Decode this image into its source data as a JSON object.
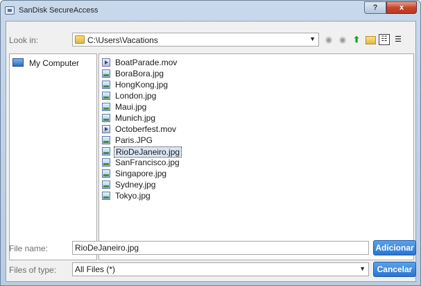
{
  "window": {
    "title": "SanDisk SecureAccess",
    "help_label": "?",
    "close_label": "x"
  },
  "toolbar": {
    "lookin_label": "Look in:",
    "lookin_path": "C:\\Users\\Vacations",
    "back_icon": "back-arrow-icon",
    "forward_icon": "forward-arrow-icon",
    "up_icon": "up-folder-icon",
    "new_folder_icon": "new-folder-icon",
    "list_view_icon": "list-view-icon",
    "details_view_icon": "details-view-icon"
  },
  "places": [
    {
      "label": "My Computer",
      "icon": "computer-icon"
    }
  ],
  "files": [
    {
      "name": "BoatParade.mov",
      "type": "movie"
    },
    {
      "name": "BoraBora.jpg",
      "type": "image"
    },
    {
      "name": "HongKong.jpg",
      "type": "image"
    },
    {
      "name": "London.jpg",
      "type": "image"
    },
    {
      "name": "Maui.jpg",
      "type": "image"
    },
    {
      "name": "Munich.jpg",
      "type": "image"
    },
    {
      "name": "Octoberfest.mov",
      "type": "movie"
    },
    {
      "name": "Paris.JPG",
      "type": "image"
    },
    {
      "name": "RioDeJaneiro.jpg",
      "type": "image",
      "selected": true
    },
    {
      "name": "SanFrancisco.jpg",
      "type": "image"
    },
    {
      "name": "Singapore.jpg",
      "type": "image"
    },
    {
      "name": "Sydney.jpg",
      "type": "image"
    },
    {
      "name": "Tokyo.jpg",
      "type": "image"
    }
  ],
  "form": {
    "filename_label": "File name:",
    "filename_value": "RioDeJaneiro.jpg",
    "filetype_label": "Files of type:",
    "filetype_value": "All Files (*)",
    "add_label": "Adicionar",
    "cancel_label": "Cancelar"
  }
}
